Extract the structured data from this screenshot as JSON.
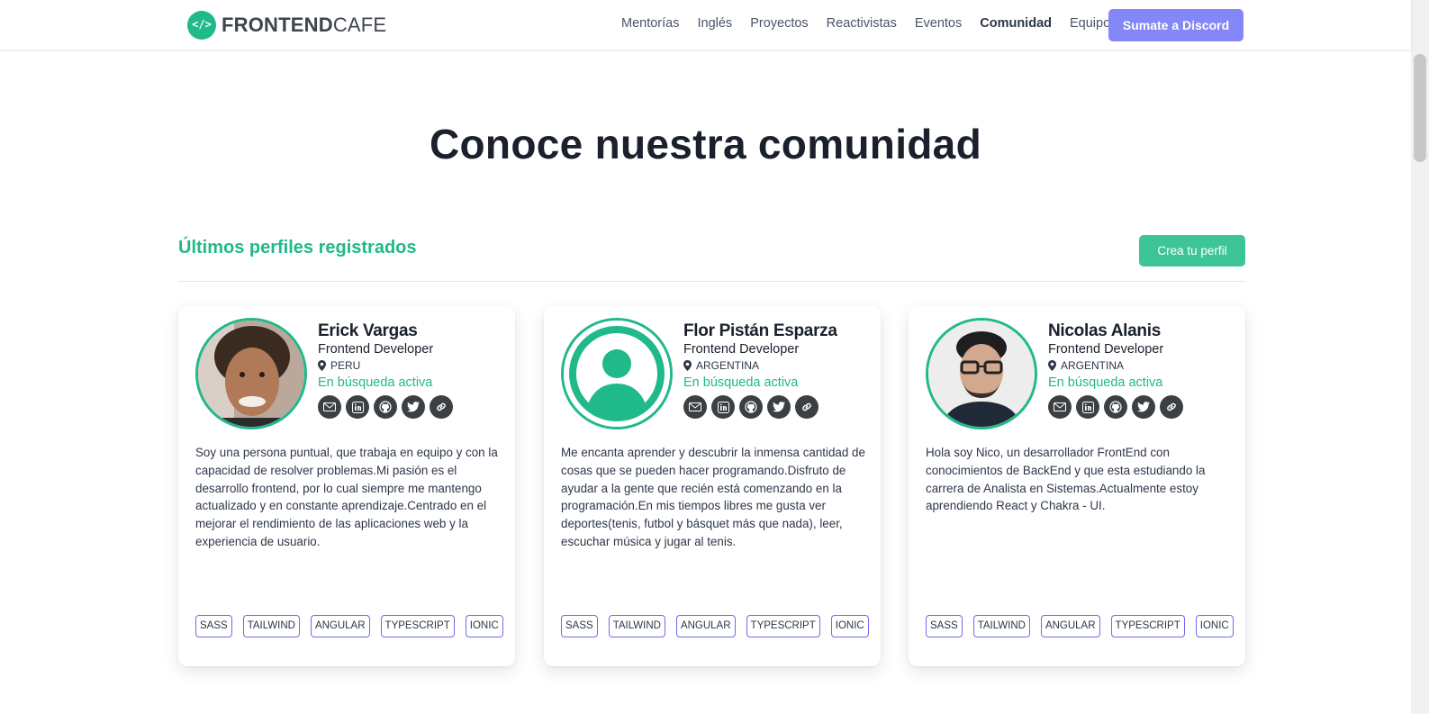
{
  "brand": {
    "bold": "FRONTEND",
    "light": "CAFE",
    "mark": "</>"
  },
  "nav": {
    "items": [
      "Mentorías",
      "Inglés",
      "Proyectos",
      "Reactivistas",
      "Eventos",
      "Comunidad",
      "Equipo"
    ],
    "active": "Comunidad",
    "cta": "Sumate a Discord"
  },
  "page": {
    "title": "Conoce nuestra comunidad",
    "section_title": "Últimos perfiles registrados",
    "create_button": "Crea tu perfil"
  },
  "profiles": [
    {
      "name": "Erick Vargas",
      "role": "Frontend Developer",
      "location": "PERU",
      "status": "En búsqueda activa",
      "avatar": "photo",
      "bio": "Soy una persona puntual, que trabaja en equipo y con la capacidad de resolver problemas.Mi pasión es el desarrollo frontend, por lo cual siempre me mantengo actualizado y en constante aprendizaje.Centrado en el mejorar el rendimiento de las aplicaciones web y la experiencia de usuario.",
      "tags": [
        "SASS",
        "TAILWIND",
        "ANGULAR",
        "TYPESCRIPT",
        "IONIC"
      ]
    },
    {
      "name": "Flor Pistán Esparza",
      "role": "Frontend Developer",
      "location": "ARGENTINA",
      "status": "En búsqueda activa",
      "avatar": "placeholder",
      "bio": "Me encanta aprender y descubrir la inmensa cantidad de cosas que se pueden hacer programando.Disfruto de ayudar a la gente que recién está comenzando en la programación.En mis tiempos libres me gusta ver deportes(tenis, futbol y básquet más que nada), leer, escuchar música y jugar al tenis.",
      "tags": [
        "SASS",
        "TAILWIND",
        "ANGULAR",
        "TYPESCRIPT",
        "IONIC"
      ]
    },
    {
      "name": "Nicolas Alanis",
      "role": "Frontend Developer",
      "location": "ARGENTINA",
      "status": "En búsqueda activa",
      "avatar": "photo",
      "bio": "Hola soy Nico, un desarrollador FrontEnd con conocimientos de BackEnd y que esta estudiando la carrera de Analista en Sistemas.Actualmente estoy aprendiendo React y Chakra - UI.",
      "tags": [
        "SASS",
        "TAILWIND",
        "ANGULAR",
        "TYPESCRIPT",
        "IONIC"
      ]
    }
  ],
  "social_icons": [
    "email-icon",
    "linkedin-icon",
    "github-icon",
    "twitter-icon",
    "link-icon"
  ],
  "colors": {
    "accent": "#1fb98a",
    "discord": "#8387f8",
    "create": "#3ec596",
    "tag_border": "#6f6af0"
  }
}
